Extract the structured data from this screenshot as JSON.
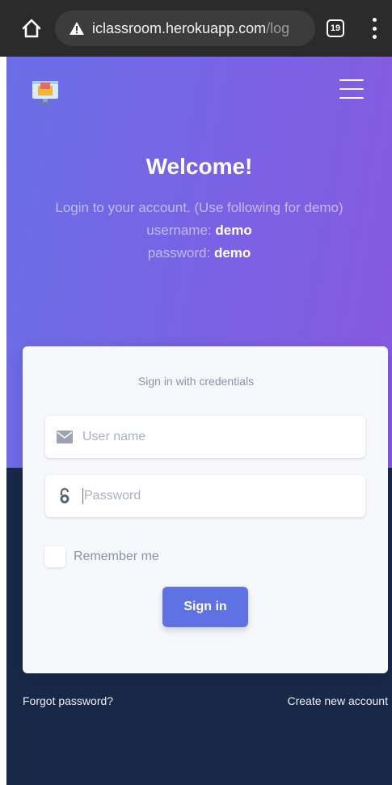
{
  "browser": {
    "url_host": "iclassroom.herokuapp.com",
    "url_path": "/log",
    "tab_count": "19"
  },
  "hero": {
    "title": "Welcome!",
    "subtitle": "Login to your account. (Use following for demo)",
    "username_label": "username:",
    "username_value": "demo",
    "password_label": "password:",
    "password_value": "demo"
  },
  "form": {
    "heading": "Sign in with credentials",
    "username_placeholder": "User name",
    "password_placeholder": "Password",
    "remember_label": "Remember me",
    "submit_label": "Sign in"
  },
  "footer": {
    "forgot": "Forgot password?",
    "create": "Create new account"
  },
  "colors": {
    "primary": "#5e72e4",
    "gradient_start": "#6a6ee6",
    "gradient_end": "#875ae0",
    "dark_bg": "#182848"
  },
  "icons": {
    "home": "home-icon",
    "warning": "warning-icon",
    "tabs": "tab-switcher-icon",
    "menu": "more-vert-icon",
    "logo": "monitor-logo-icon",
    "hamburger": "hamburger-icon",
    "email": "envelope-icon",
    "lock": "lock-open-icon"
  }
}
